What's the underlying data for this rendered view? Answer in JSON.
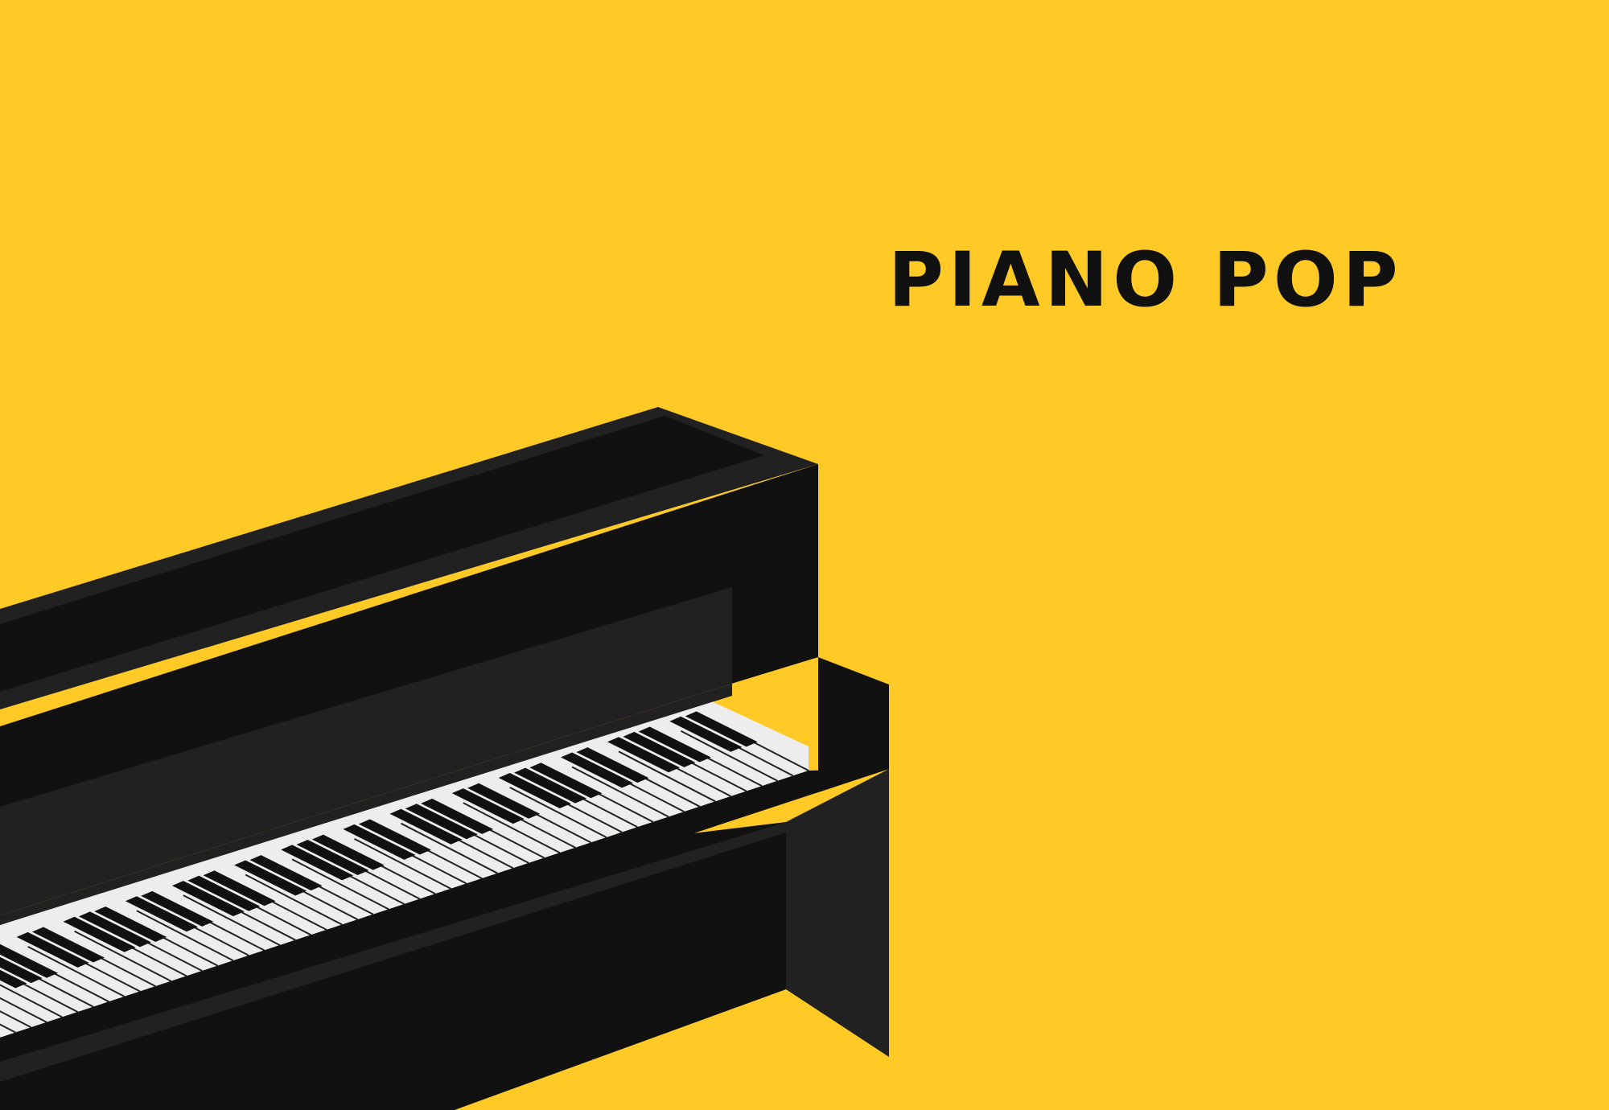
{
  "title": "PIANO POP",
  "colors": {
    "background": "#FFCA26",
    "title_text": "#111111",
    "piano_dark": "#111111",
    "piano_mid": "#212121",
    "piano_light": "#2A2A2A",
    "white_key": "#EDEDED",
    "key_line": "#222222"
  },
  "icons": {
    "illustration": "upright-piano-icon"
  }
}
